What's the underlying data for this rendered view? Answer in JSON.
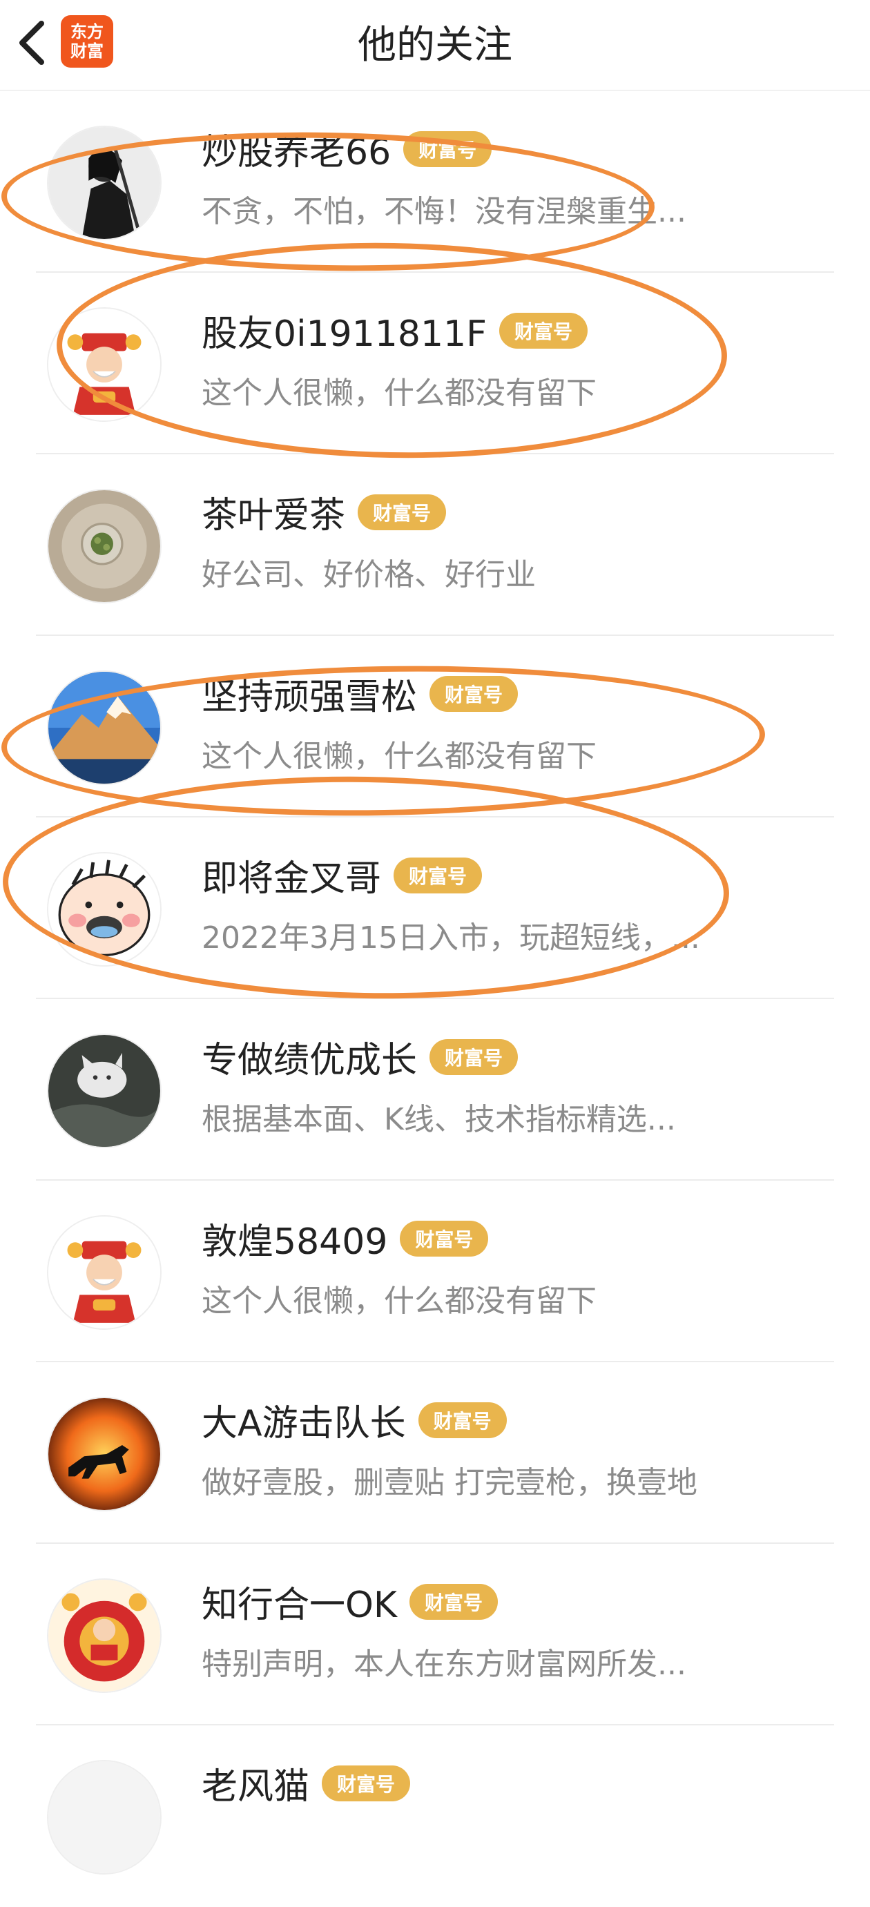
{
  "header": {
    "title": "他的关注",
    "logo_text": "东方财富"
  },
  "list": [
    {
      "name": "炒股养老66",
      "badge": "财富号",
      "bio": "不贪，不怕，不悔！没有涅槃重生...",
      "avatar": "swordsman-avatar"
    },
    {
      "name": "股友0i1911811F",
      "badge": "财富号",
      "bio": "这个人很懒，什么都没有留下",
      "avatar": "god-of-wealth-avatar"
    },
    {
      "name": "茶叶爱茶",
      "badge": "财富号",
      "bio": "好公司、好价格、好行业",
      "avatar": "tea-avatar"
    },
    {
      "name": "坚持顽强雪松",
      "badge": "财富号",
      "bio": "这个人很懒，什么都没有留下",
      "avatar": "snow-mountain-avatar"
    },
    {
      "name": "即将金叉哥",
      "badge": "财富号",
      "bio": "2022年3月15日入市，玩超短线，...",
      "avatar": "cartoon-face-avatar"
    },
    {
      "name": "专做绩优成长",
      "badge": "财富号",
      "bio": "根据基本面、K线、技术指标精选...",
      "avatar": "cat-avatar"
    },
    {
      "name": "敦煌58409",
      "badge": "财富号",
      "bio": "这个人很懒，什么都没有留下",
      "avatar": "god-of-wealth-avatar"
    },
    {
      "name": "大A游击队长",
      "badge": "财富号",
      "bio": "做好壹股，删壹贴 打完壹枪，换壹地",
      "avatar": "horse-sunset-avatar"
    },
    {
      "name": "知行合一OK",
      "badge": "财富号",
      "bio": "特别声明，本人在东方财富网所发...",
      "avatar": "festival-avatar"
    },
    {
      "name": "老风猫",
      "badge": "财富号",
      "bio": "",
      "avatar": "partial-avatar"
    }
  ],
  "colors": {
    "badge": "#e9b54d",
    "annotation": "#f08c3c",
    "logo": "#f0561d"
  }
}
